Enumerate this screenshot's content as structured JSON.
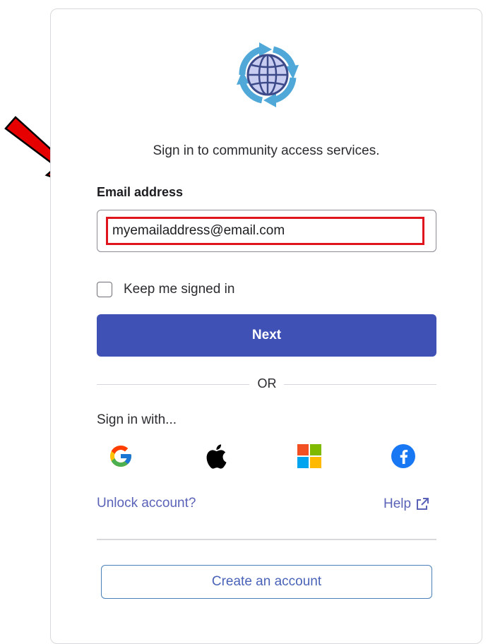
{
  "header": {
    "subtitle": "Sign in to community access services."
  },
  "form": {
    "email_label": "Email address",
    "email_value": "myemailaddress@email.com",
    "keep_signed_in_label": "Keep me signed in",
    "keep_signed_in_checked": false,
    "next_label": "Next"
  },
  "separator": {
    "label": "OR"
  },
  "social": {
    "heading": "Sign in with...",
    "providers": [
      {
        "name": "Google",
        "icon": "google-icon"
      },
      {
        "name": "Apple",
        "icon": "apple-icon"
      },
      {
        "name": "Microsoft",
        "icon": "microsoft-icon"
      },
      {
        "name": "Facebook",
        "icon": "facebook-icon"
      }
    ]
  },
  "links": {
    "unlock": "Unlock account?",
    "help": "Help"
  },
  "footer": {
    "create_account_label": "Create an account"
  },
  "colors": {
    "primary_button": "#3f51b5",
    "link": "#5a63b8",
    "highlight": "#e0141c",
    "arrow": "#e60000"
  }
}
